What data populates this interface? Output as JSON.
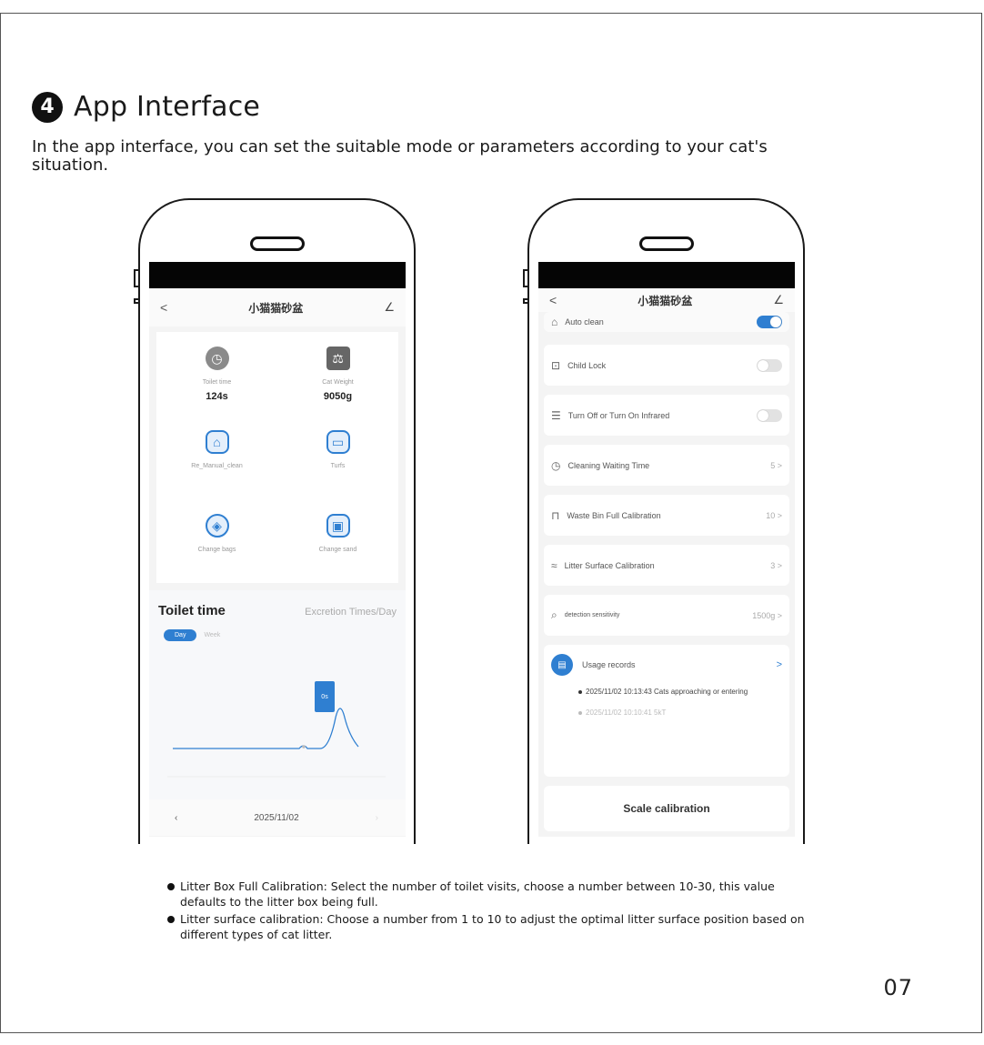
{
  "section": {
    "number": "4",
    "title": "App Interface",
    "intro": "In the app interface, you can set the suitable mode or parameters according to your cat's situation."
  },
  "phone1": {
    "nav_title": "小猫猫砂盆",
    "back": "<",
    "edit": "∠",
    "tiles": [
      {
        "label": "Toilet time",
        "value": "124s",
        "icon": "clock-icon"
      },
      {
        "label": "Cat Weight",
        "value": "9050g",
        "icon": "scale-icon"
      },
      {
        "label": "Re_Manual_clean",
        "value": "",
        "icon": "clean-icon"
      },
      {
        "label": "Turfs",
        "value": "",
        "icon": "bin-icon"
      },
      {
        "label": "Change bags",
        "value": "",
        "icon": "bag-icon"
      },
      {
        "label": "Change sand",
        "value": "",
        "icon": "sand-icon"
      }
    ],
    "chart_title": "Toilet time",
    "chart_tab2": "Excretion Times/Day",
    "pill_day": "Day",
    "pill_week": "Week",
    "tooltip": "0s",
    "date": "2025/11/02",
    "prev": "‹",
    "next": "›"
  },
  "phone2": {
    "nav_title": "小猫猫砂盆",
    "back": "<",
    "edit": "∠",
    "rows": [
      {
        "label": "Auto clean",
        "value": "",
        "icon": "broom-icon"
      },
      {
        "label": "Child Lock",
        "value": "",
        "icon": "lock-icon"
      },
      {
        "label": "Turn Off or Turn On Infrared",
        "value": "",
        "icon": "infrared-icon"
      },
      {
        "label": "Cleaning Waiting Time",
        "value": "5 >",
        "icon": "timer-icon"
      },
      {
        "label": "Waste Bin Full Calibration",
        "value": "10 >",
        "icon": "bin-icon"
      },
      {
        "label": "Litter Surface Calibration",
        "value": "3 >",
        "icon": "surface-icon"
      },
      {
        "label": "detection sensitivity",
        "value": "1500g >",
        "icon": "search-icon"
      }
    ],
    "usage_title": "Usage records",
    "usage_arrow": ">",
    "record1": "2025/11/02 10:13:43 Cats approaching or entering",
    "record2": "2025/11/02 10:10:41 5kT",
    "scale_btn": "Scale calibration"
  },
  "notes": [
    "Litter Box Full Calibration: Select the number of toilet visits, choose a number between 10-30, this value defaults to the litter box being full.",
    "Litter surface calibration: Choose a number from 1 to 10 to adjust the optimal litter surface position based on different types of cat litter."
  ],
  "page_number": "07"
}
